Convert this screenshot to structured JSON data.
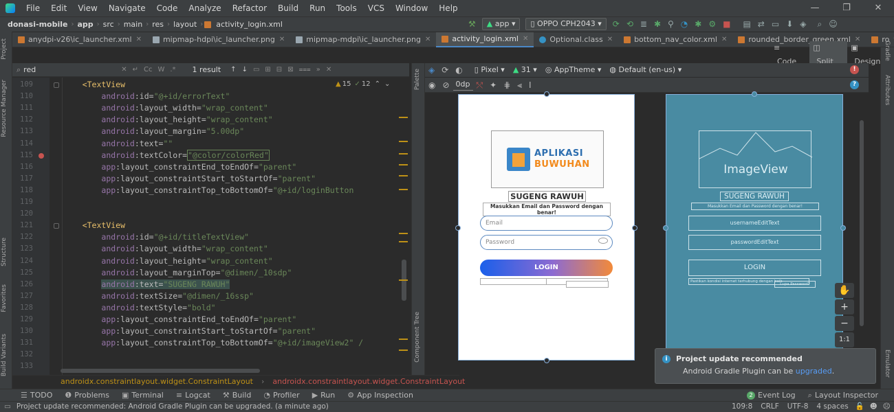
{
  "menu": [
    "File",
    "Edit",
    "View",
    "Navigate",
    "Code",
    "Analyze",
    "Refactor",
    "Build",
    "Run",
    "Tools",
    "VCS",
    "Window",
    "Help"
  ],
  "window_controls": [
    "—",
    "❐",
    "✕"
  ],
  "breadcrumb": [
    "donasi-mobile",
    "app",
    "src",
    "main",
    "res",
    "layout",
    "activity_login.xml"
  ],
  "run_config": "app",
  "device": "OPPO CPH2043",
  "tabs": [
    {
      "label": "anydpi-v26\\ic_launcher.xml",
      "color": "#cc7832"
    },
    {
      "label": "mipmap-hdpi\\ic_launcher.png",
      "color": "#9aa7b0"
    },
    {
      "label": "mipmap-mdpi\\ic_launcher.png",
      "color": "#9aa7b0"
    },
    {
      "label": "activity_login.xml",
      "color": "#cc7832"
    },
    {
      "label": "Optional.class",
      "color": "#3592c4"
    },
    {
      "label": "bottom_nav_color.xml",
      "color": "#cc7832"
    },
    {
      "label": "rounded_border_green.xml",
      "color": "#cc7832"
    },
    {
      "label": "ro",
      "color": "#cc7832"
    }
  ],
  "view_modes": {
    "code": "Code",
    "split": "Split",
    "design": "Design"
  },
  "search": {
    "query": "red",
    "opts": [
      "Cc",
      "W",
      ".*"
    ],
    "result": "1 result"
  },
  "inspection": {
    "warnings": "15",
    "weak": "12"
  },
  "code": [
    {
      "n": "109",
      "indent": "    ",
      "tag": "<TextView"
    },
    {
      "n": "110",
      "indent": "        ",
      "ns": "android",
      "attr": "id",
      "val": "\"@+id/errorText\""
    },
    {
      "n": "111",
      "indent": "        ",
      "ns": "android",
      "attr": "layout_width",
      "val": "\"wrap_content\""
    },
    {
      "n": "112",
      "indent": "        ",
      "ns": "android",
      "attr": "layout_height",
      "val": "\"wrap_content\""
    },
    {
      "n": "113",
      "indent": "        ",
      "ns": "android",
      "attr": "layout_margin",
      "val": "\"5.00dp\""
    },
    {
      "n": "114",
      "indent": "        ",
      "ns": "android",
      "attr": "text",
      "val": "\"\""
    },
    {
      "n": "115",
      "indent": "        ",
      "ns": "android",
      "attr": "textColor",
      "val": "\"@color/colorRed\""
    },
    {
      "n": "116",
      "indent": "        ",
      "ns": "app",
      "attr": "layout_constraintEnd_toEndOf",
      "val": "\"parent\""
    },
    {
      "n": "117",
      "indent": "        ",
      "ns": "app",
      "attr": "layout_constraintStart_toStartOf",
      "val": "\"parent\""
    },
    {
      "n": "118",
      "indent": "        ",
      "ns": "app",
      "attr": "layout_constraintTop_toBottomOf",
      "val": "\"@+id/loginButton"
    },
    {
      "n": "119",
      "indent": ""
    },
    {
      "n": "120",
      "indent": ""
    },
    {
      "n": "121",
      "indent": "    ",
      "tag": "<TextView"
    },
    {
      "n": "122",
      "indent": "        ",
      "ns": "android",
      "attr": "id",
      "val": "\"@+id/titleTextView\""
    },
    {
      "n": "123",
      "indent": "        ",
      "ns": "android",
      "attr": "layout_width",
      "val": "\"wrap_content\""
    },
    {
      "n": "124",
      "indent": "        ",
      "ns": "android",
      "attr": "layout_height",
      "val": "\"wrap_content\""
    },
    {
      "n": "125",
      "indent": "        ",
      "ns": "android",
      "attr": "layout_marginTop",
      "val": "\"@dimen/_10sdp\""
    },
    {
      "n": "126",
      "indent": "        ",
      "ns": "android",
      "attr": "text",
      "val": "\"SUGENG RAWUH\""
    },
    {
      "n": "127",
      "indent": "        ",
      "ns": "android",
      "attr": "textSize",
      "val": "\"@dimen/_16ssp\""
    },
    {
      "n": "128",
      "indent": "        ",
      "ns": "android",
      "attr": "textStyle",
      "val": "\"bold\""
    },
    {
      "n": "129",
      "indent": "        ",
      "ns": "app",
      "attr": "layout_constraintEnd_toEndOf",
      "val": "\"parent\""
    },
    {
      "n": "130",
      "indent": "        ",
      "ns": "app",
      "attr": "layout_constraintStart_toStartOf",
      "val": "\"parent\""
    },
    {
      "n": "131",
      "indent": "        ",
      "ns": "app",
      "attr": "layout_constraintTop_toBottomOf",
      "val": "\"@+id/imageView2\" /"
    },
    {
      "n": "132",
      "indent": ""
    },
    {
      "n": "133",
      "indent": ""
    }
  ],
  "editor_breadcrumb": [
    "androidx.constraintlayout.widget.ConstraintLayout",
    "androidx.constraintlayout.widget.ConstraintLayout"
  ],
  "side_tools": {
    "project": "Project",
    "resource_manager": "Resource Manager",
    "structure": "Structure",
    "favorites": "Favorites",
    "build_variants": "Build Variants",
    "palette": "Palette",
    "component_tree": "Component Tree",
    "gradle": "Gradle",
    "attributes": "Attributes",
    "emulator": "Emulator"
  },
  "design_toolbar": {
    "device": "Pixel",
    "api": "31",
    "theme": "AppTheme",
    "locale": "Default (en-us)",
    "margin": "0dp"
  },
  "preview": {
    "logo_line1": "APLIKASI",
    "logo_line2": "BUWUHAN",
    "title": "SUGENG RAWUH",
    "subtitle": "Masukkan Email dan Password dengan benar!",
    "email_hint": "Email",
    "password_hint": "Password",
    "login": "LOGIN"
  },
  "blueprint": {
    "image": "ImageView",
    "title": "SUGENG RAWUH",
    "subtitle": "Masukkan Email dan Password dengan benar!",
    "username": "usernameEditText",
    "password": "passwordEditText",
    "login": "LOGIN",
    "footer_left": "Pastikan kondisi internet terhubung dengan baik",
    "footer_right": "Lupa Password?"
  },
  "zoom": {
    "in": "+",
    "out": "−",
    "fit": "1:1"
  },
  "notification": {
    "title": "Project update recommended",
    "body": "Android Gradle Plugin can be",
    "link": "upgraded",
    "suffix": "."
  },
  "tool_windows": [
    {
      "icon": "☰",
      "label": "TODO"
    },
    {
      "icon": "❶",
      "label": "Problems"
    },
    {
      "icon": "▣",
      "label": "Terminal"
    },
    {
      "icon": "≡",
      "label": "Logcat"
    },
    {
      "icon": "⚒",
      "label": "Build"
    },
    {
      "icon": "◔",
      "label": "Profiler"
    },
    {
      "icon": "▶",
      "label": "Run"
    },
    {
      "icon": "⚙",
      "label": "App Inspection"
    }
  ],
  "right_tool_windows": [
    {
      "icon": "2",
      "label": "Event Log"
    },
    {
      "icon": "⌕",
      "label": "Layout Inspector"
    }
  ],
  "status": {
    "message": "Project update recommended: Android Gradle Plugin can be upgraded. (a minute ago)",
    "position": "109:8",
    "line_sep": "CRLF",
    "encoding": "UTF-8",
    "indent": "4 spaces"
  }
}
